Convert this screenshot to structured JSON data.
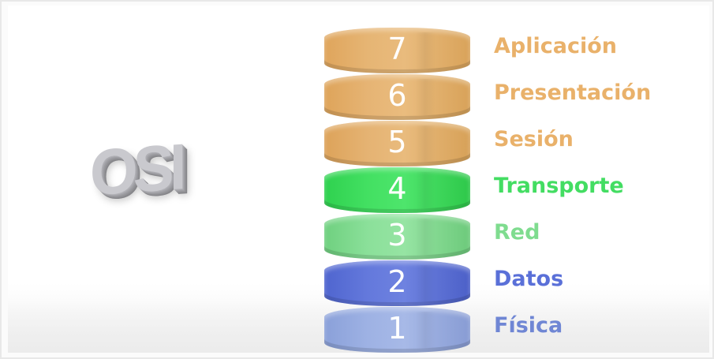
{
  "logo": {
    "text": "OSI",
    "color": "#c9c9ce"
  },
  "layers": [
    {
      "number": "7",
      "name": "Aplicación",
      "color": "#e9b16a"
    },
    {
      "number": "6",
      "name": "Presentación",
      "color": "#e9b16a"
    },
    {
      "number": "5",
      "name": "Sesión",
      "color": "#e9b16a"
    },
    {
      "number": "4",
      "name": "Transporte",
      "color": "#43dd62"
    },
    {
      "number": "3",
      "name": "Red",
      "color": "#7fdc8f"
    },
    {
      "number": "2",
      "name": "Datos",
      "color": "#5a70d8"
    },
    {
      "number": "1",
      "name": "Física",
      "color": "#6f86d4"
    }
  ]
}
